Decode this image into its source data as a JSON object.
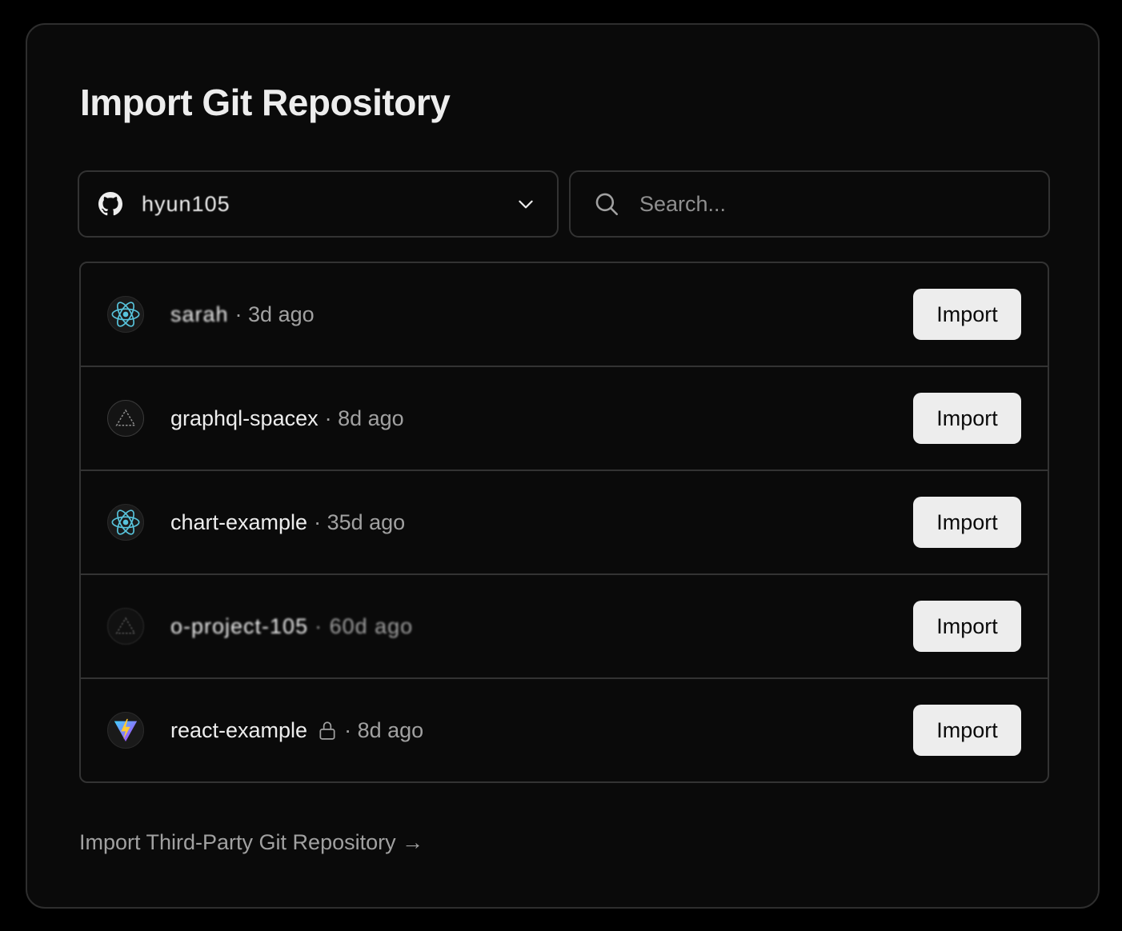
{
  "page": {
    "title": "Import Git Repository",
    "third_party_link": "Import Third-Party Git Repository →"
  },
  "scope_selector": {
    "icon": "github-icon",
    "account_name": "hyun105"
  },
  "search": {
    "placeholder": "Search..."
  },
  "repositories": [
    {
      "icon": "react-icon",
      "name": "sarah",
      "time": "· 3d ago",
      "private": false,
      "button_label": "Import"
    },
    {
      "icon": "triangle-icon",
      "name": "graphql-spacex",
      "time": "· 8d ago",
      "private": false,
      "button_label": "Import"
    },
    {
      "icon": "react-icon",
      "name": "chart-example",
      "time": "· 35d ago",
      "private": false,
      "button_label": "Import"
    },
    {
      "icon": "triangle-icon",
      "name": "o-project-105",
      "time": "· 60d ago",
      "private": false,
      "button_label": "Import"
    },
    {
      "icon": "vite-icon",
      "name": "react-example",
      "time": "· 8d ago",
      "private": true,
      "button_label": "Import"
    }
  ],
  "colors": {
    "background": "#000000",
    "card": "#0a0a0a",
    "border": "#333333",
    "button_bg": "#ededed",
    "react_blue": "#58c4dc",
    "vite_purple": "#a855f7",
    "vite_yellow": "#ffcc33"
  }
}
